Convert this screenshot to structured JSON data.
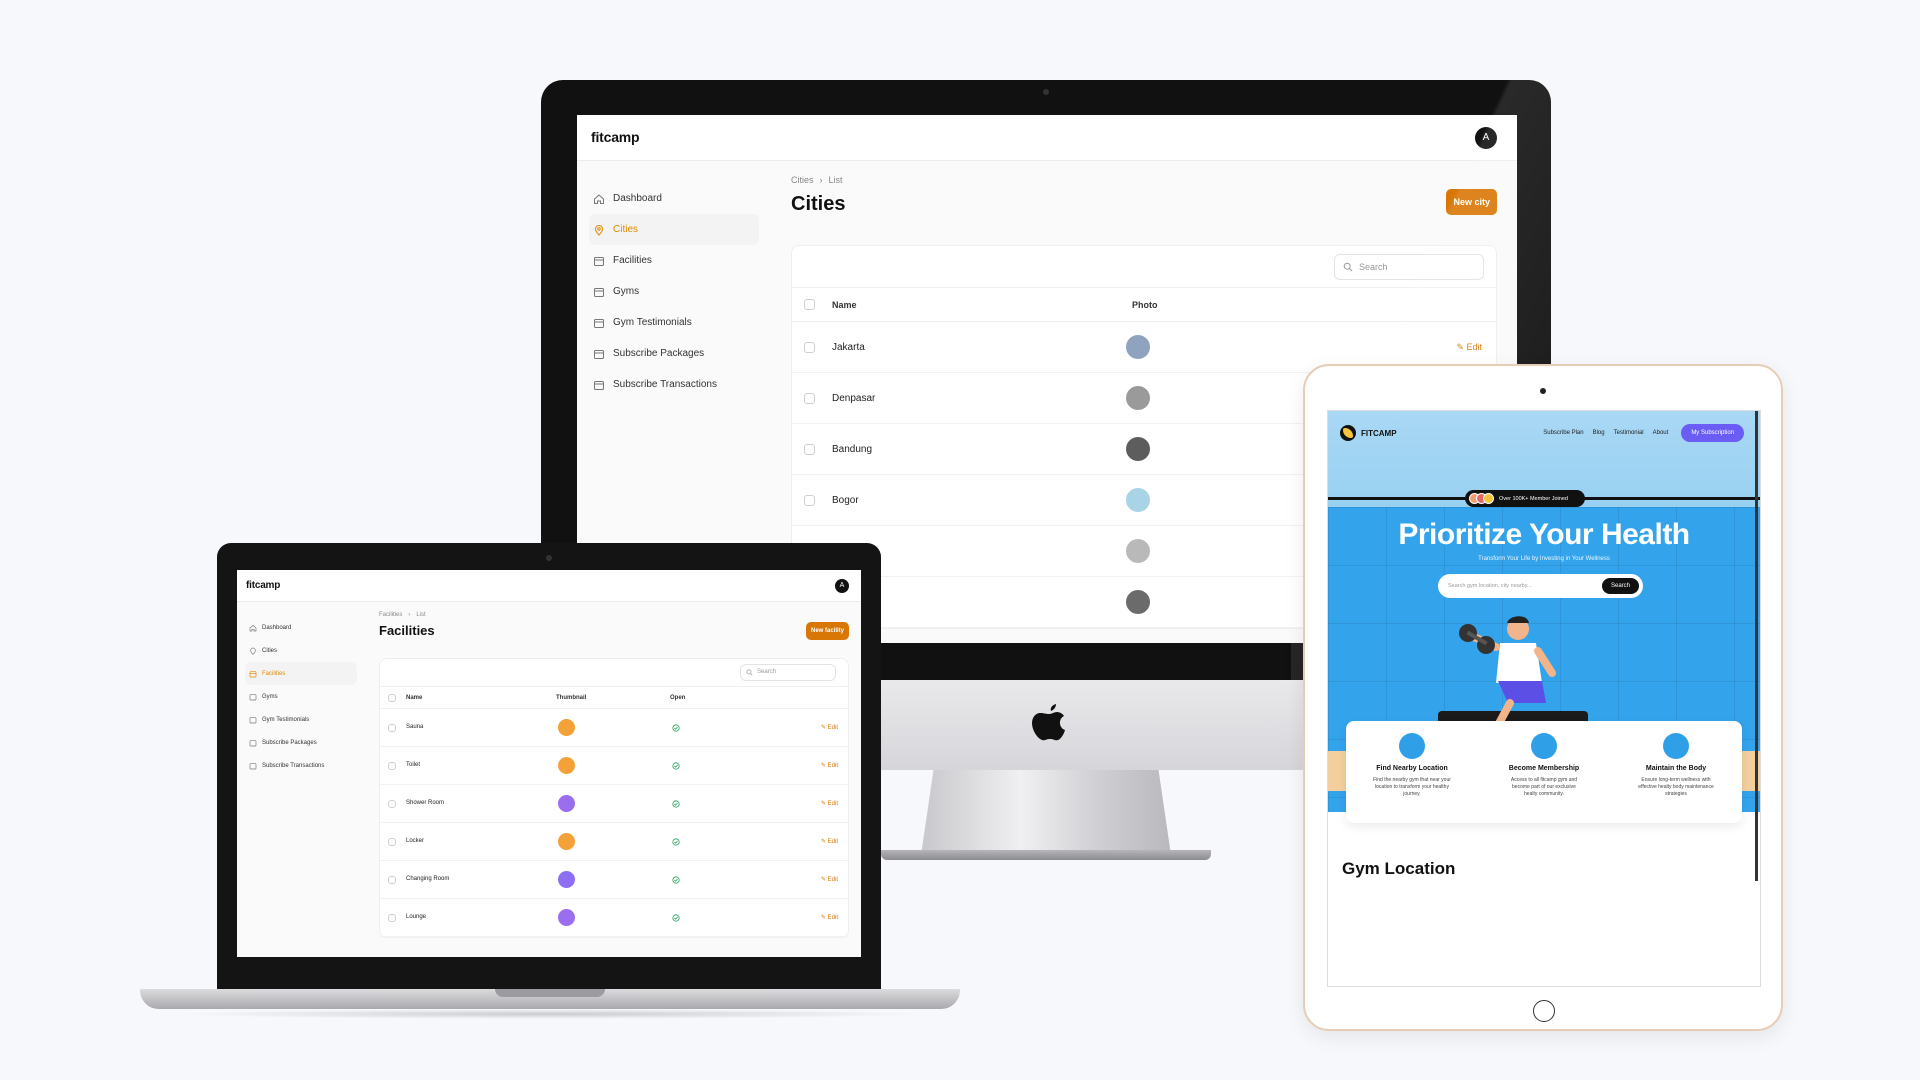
{
  "admin": {
    "brand": "fitcamp",
    "avatar": "A",
    "nav": [
      "Dashboard",
      "Cities",
      "Facilities",
      "Gyms",
      "Gym Testimonials",
      "Subscribe Packages",
      "Subscribe Transactions"
    ]
  },
  "cities_page": {
    "breadcrumb": [
      "Cities",
      "List"
    ],
    "title": "Cities",
    "new_button": "New city",
    "search_placeholder": "Search",
    "columns": [
      "Name",
      "Photo"
    ],
    "rows": [
      {
        "name": "Jakarta",
        "thumb_color": "#8fa3bf",
        "edit": "Edit"
      },
      {
        "name": "Denpasar",
        "thumb_color": "#9a9a9a",
        "edit": ""
      },
      {
        "name": "Bandung",
        "thumb_color": "#5d5d5d",
        "edit": ""
      },
      {
        "name": "Bogor",
        "thumb_color": "#a9d3e6",
        "edit": ""
      },
      {
        "name": "",
        "thumb_color": "#b9b9b9",
        "edit": ""
      },
      {
        "name": "",
        "thumb_color": "#6b6b6b",
        "edit": ""
      }
    ]
  },
  "facilities_page": {
    "breadcrumb": [
      "Facilities",
      "List"
    ],
    "title": "Facilities",
    "new_button": "New facility",
    "search_placeholder": "Search",
    "columns": [
      "Name",
      "Thumbnail",
      "Open"
    ],
    "rows": [
      {
        "name": "Sauna",
        "thumb_color": "#f4a13a",
        "edit": "Edit"
      },
      {
        "name": "Toilet",
        "thumb_color": "#f4a13a",
        "edit": "Edit"
      },
      {
        "name": "Shower Room",
        "thumb_color": "#9b6ef0",
        "edit": "Edit"
      },
      {
        "name": "Locker",
        "thumb_color": "#f4a13a",
        "edit": "Edit"
      },
      {
        "name": "Changing Room",
        "thumb_color": "#8e6ef2",
        "edit": "Edit"
      },
      {
        "name": "Lounge",
        "thumb_color": "#9b6ef0",
        "edit": "Edit"
      }
    ]
  },
  "landing": {
    "logo": "FITCAMP",
    "nav": [
      "Subscribe Plan",
      "Blog",
      "Testimonial",
      "About"
    ],
    "cta": "My Subscription",
    "badge": "Over 100K+ Member Joined",
    "headline": "Prioritize Your Health",
    "subheadline": "Transform Your Life by Investing in Your Wellness",
    "search_placeholder": "Search gym location, city nearby...",
    "search_button": "Search",
    "features": [
      {
        "title": "Find Nearby Location",
        "desc": "Find the nearby gym that near your location to transform your healthy journey.",
        "color": "#2fa0e8"
      },
      {
        "title": "Become Membership",
        "desc": "Access to all fitcamp gym and become part of our exclusive healty community.",
        "color": "#2fa0e8"
      },
      {
        "title": "Maintain the Body",
        "desc": "Ensure long-term wellness with effective healty body maintenance strategies",
        "color": "#2fa0e8"
      }
    ],
    "section_title": "Gym Location"
  },
  "colors": {
    "accent": "#d97706",
    "hero": "#33a3ec",
    "cta": "#6b5cf6"
  }
}
